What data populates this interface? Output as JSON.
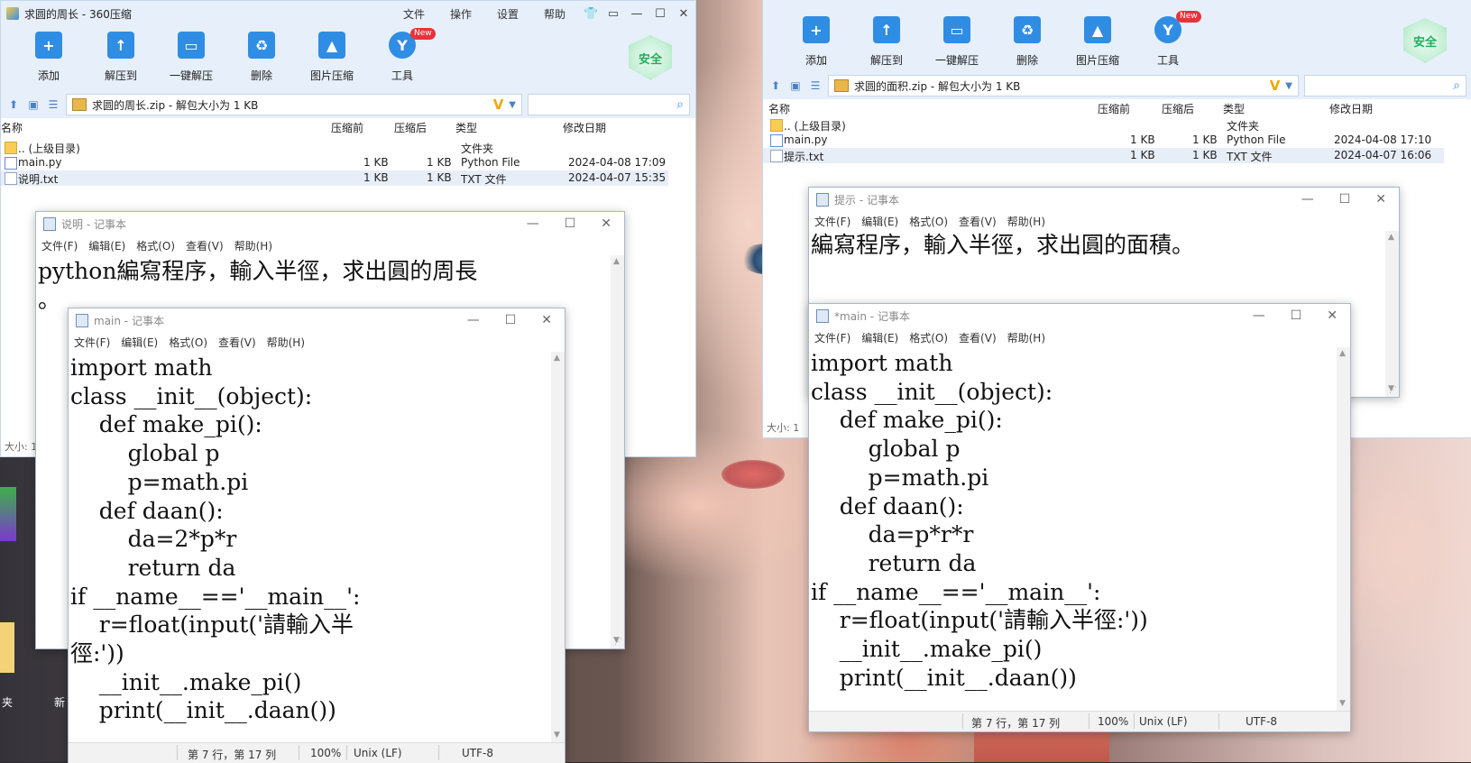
{
  "left_zip": {
    "title": "求圆的周长 - 360压缩",
    "menu": [
      "文件",
      "操作",
      "设置",
      "帮助"
    ],
    "tools": [
      {
        "label": "添加",
        "icon": "add-icon"
      },
      {
        "label": "解压到",
        "icon": "extract-icon"
      },
      {
        "label": "一键解压",
        "icon": "one-click-extract-icon"
      },
      {
        "label": "删除",
        "icon": "delete-icon"
      },
      {
        "label": "图片压缩",
        "icon": "image-compress-icon"
      },
      {
        "label": "工具",
        "icon": "tools-icon"
      }
    ],
    "new_badge": "New",
    "security": "安全",
    "address": "求圆的周长.zip - 解包大小为 1 KB",
    "address_v": "V",
    "columns": {
      "name": "名称",
      "before": "压缩前",
      "after": "压缩后",
      "type": "类型",
      "date": "修改日期"
    },
    "files": [
      {
        "name": ".. (上级目录)",
        "before": "",
        "after": "",
        "type": "文件夹",
        "date": ""
      },
      {
        "name": "main.py",
        "before": "1 KB",
        "after": "1 KB",
        "type": "Python File",
        "date": "2024-04-08 17:09"
      },
      {
        "name": "说明.txt",
        "before": "1 KB",
        "after": "1 KB",
        "type": "TXT 文件",
        "date": "2024-04-07 15:35"
      }
    ],
    "status": "大小: 1"
  },
  "right_zip": {
    "tools": [
      {
        "label": "添加",
        "icon": "add-icon"
      },
      {
        "label": "解压到",
        "icon": "extract-icon"
      },
      {
        "label": "一键解压",
        "icon": "one-click-extract-icon"
      },
      {
        "label": "删除",
        "icon": "delete-icon"
      },
      {
        "label": "图片压缩",
        "icon": "image-compress-icon"
      },
      {
        "label": "工具",
        "icon": "tools-icon"
      }
    ],
    "new_badge": "New",
    "security": "安全",
    "address": "求圆的面积.zip - 解包大小为 1 KB",
    "address_v": "V",
    "columns": {
      "name": "名称",
      "before": "压缩前",
      "after": "压缩后",
      "type": "类型",
      "date": "修改日期"
    },
    "files": [
      {
        "name": ".. (上级目录)",
        "before": "",
        "after": "",
        "type": "文件夹",
        "date": ""
      },
      {
        "name": "main.py",
        "before": "1 KB",
        "after": "1 KB",
        "type": "Python File",
        "date": "2024-04-08 17:10"
      },
      {
        "name": "提示.txt",
        "before": "1 KB",
        "after": "1 KB",
        "type": "TXT 文件",
        "date": "2024-04-07 16:06"
      }
    ],
    "status": "大小: 1"
  },
  "notepad_menu": [
    "文件(F)",
    "编辑(E)",
    "格式(O)",
    "查看(V)",
    "帮助(H)"
  ],
  "np_shuoming": {
    "title": "说明 - 记事本",
    "text": "python編寫程序，輸入半徑，求出圓的周長\n。"
  },
  "np_main_left": {
    "title": "main - 记事本",
    "text": "import math\nclass __init__(object):\n    def make_pi():\n        global p\n        p=math.pi\n    def daan():\n        da=2*p*r\n        return da\nif __name__=='__main__':\n    r=float(input('請輸入半\n徑:'))\n    __init__.make_pi()\n    print(__init__.daan())",
    "status": {
      "pos": "第 7 行，第 17 列",
      "zoom": "100%",
      "eol": "Unix (LF)",
      "enc": "UTF-8"
    }
  },
  "np_tishi": {
    "title": "提示 - 记事本",
    "text": "編寫程序，輸入半徑，求出圓的面積。"
  },
  "np_main_right": {
    "title": "*main - 记事本",
    "text": "import math\nclass __init__(object):\n    def make_pi():\n        global p\n        p=math.pi\n    def daan():\n        da=p*r*r\n        return da\nif __name__=='__main__':\n    r=float(input('請輸入半徑:'))\n    __init__.make_pi()\n    print(__init__.daan())",
    "status": {
      "pos": "第 7 行，第 17 列",
      "zoom": "100%",
      "eol": "Unix (LF)",
      "enc": "UTF-8"
    }
  },
  "desktop": {
    "label1": "夹",
    "label2": "新"
  }
}
